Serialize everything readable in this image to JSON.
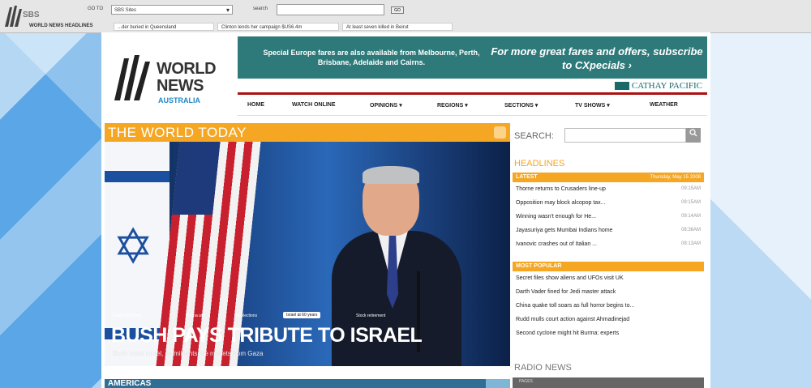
{
  "colors": {
    "accent": "#f5a623",
    "ad_bg": "#2e7a7a",
    "section_bar": "#2f6f95"
  },
  "topbar": {
    "logo_text": "SBS",
    "goto_label": "GO TO",
    "goto_value": "SBS Sites",
    "search_label": "search",
    "go_label": "GO",
    "headlines_label": "WORLD NEWS HEADLINES",
    "headlines": [
      "...der buried in Queensland",
      "Clinton lends her campaign $US6.4m",
      "At least seven killed in Beirut"
    ]
  },
  "logo": {
    "line1": "WORLD",
    "line2": "NEWS",
    "line3": "AUSTRALIA"
  },
  "ad": {
    "left_text": "Special Europe fares are also available from Melbourne, Perth, Brisbane, Adelaide and Cairns.",
    "right_text": "For more great fares and offers, subscribe to CXpecials ›",
    "brand": "CATHAY PACIFIC"
  },
  "nav": [
    {
      "label": "HOME",
      "caret": ""
    },
    {
      "label": "WATCH ONLINE",
      "caret": ""
    },
    {
      "label": "OPINIONS",
      "caret": "▾"
    },
    {
      "label": "REGIONS",
      "caret": "▾"
    },
    {
      "label": "SECTIONS",
      "caret": "▾"
    },
    {
      "label": "TV SHOWS",
      "caret": "▾"
    },
    {
      "label": "WEATHER",
      "caret": ""
    }
  ],
  "world_today": {
    "title": "THE WORLD TODAY",
    "tags": [
      "Death toll rising",
      "Burma aid",
      "US elections",
      "Israel at 60 years",
      "Stock retirement"
    ],
    "headline": "BUSH PAYS TRIBUTE TO ISRAEL",
    "subhead": "Bush visits Israel, as militants fire rockets from Gaza"
  },
  "right_column": {
    "search_label": "SEARCH:",
    "search_icon": "magnifier-icon",
    "headlines_title": "HEADLINES",
    "latest_label": "LATEST",
    "latest_date": "Thursday, May 15 2008",
    "latest": [
      {
        "text": "Thorne returns to Crusaders line-up",
        "time": "09:15AM"
      },
      {
        "text": "Opposition may block alcopop tax...",
        "time": "09:15AM"
      },
      {
        "text": "Winning wasn't enough for He...",
        "time": "09:14AM"
      },
      {
        "text": "Jayasuriya gets Mumbai Indians home",
        "time": "08:36AM"
      },
      {
        "text": "Ivanovic crashes out of Italian ...",
        "time": "08:13AM"
      }
    ],
    "popular_label": "MOST POPULAR",
    "popular": [
      "Secret files show aliens and UFOs visit UK",
      "Darth Vader fined for Jedi master attack",
      "China quake toll soars as full horror begins to...",
      "Rudd mulls court action against Ahmadinejad",
      "Second cyclone might hit Burma: experts"
    ],
    "radio_title": "RADIO NEWS",
    "radio_bar": "PAGES"
  },
  "americas": {
    "label": "AMERICAS"
  }
}
